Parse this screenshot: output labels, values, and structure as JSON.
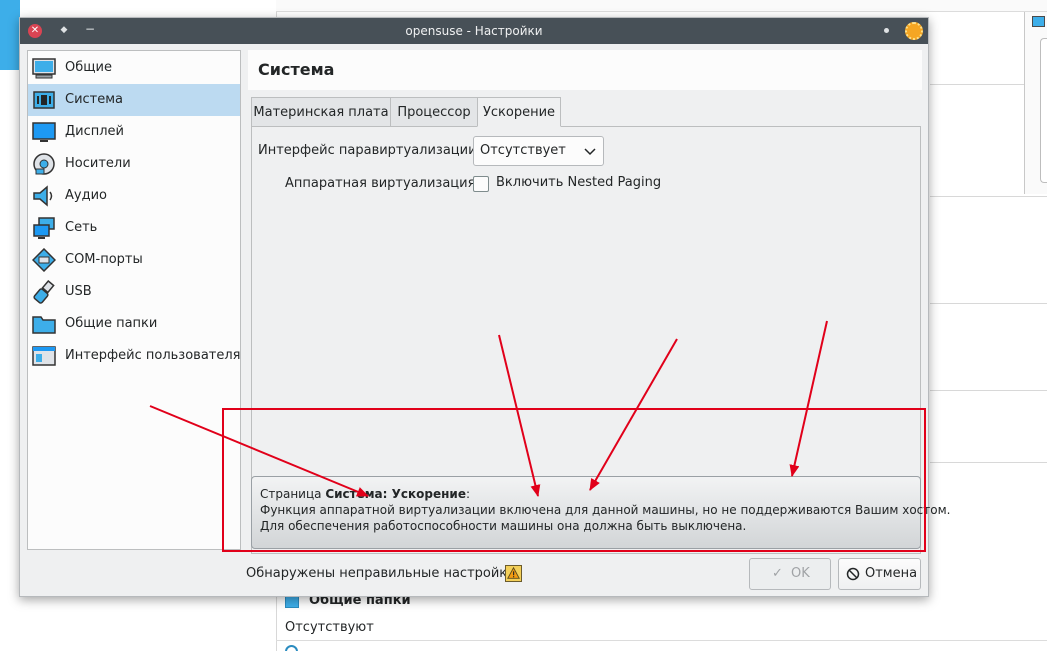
{
  "dialog": {
    "title": "opensuse - Настройки"
  },
  "sidebar": {
    "items": [
      {
        "label": "Общие",
        "icon": "general-icon"
      },
      {
        "label": "Система",
        "icon": "chip-icon",
        "selected": true
      },
      {
        "label": "Дисплей",
        "icon": "monitor-icon"
      },
      {
        "label": "Носители",
        "icon": "disk-icon"
      },
      {
        "label": "Аудио",
        "icon": "speaker-icon"
      },
      {
        "label": "Сеть",
        "icon": "network-icon"
      },
      {
        "label": "COM-порты",
        "icon": "serial-port-icon"
      },
      {
        "label": "USB",
        "icon": "usb-icon"
      },
      {
        "label": "Общие папки",
        "icon": "folder-icon"
      },
      {
        "label": "Интерфейс пользователя",
        "icon": "ui-window-icon"
      }
    ]
  },
  "page": {
    "title": "Система",
    "tabs": [
      {
        "label": "Материнская плата"
      },
      {
        "label": "Процессор"
      },
      {
        "label": "Ускорение",
        "active": true
      }
    ],
    "paravirt_label": "Интерфейс паравиртуализации:",
    "paravirt_value": "Отсутствует",
    "hwvirt_label": "Аппаратная виртуализация:",
    "nested_paging_label": "Включить Nested Paging",
    "nested_paging_checked": false
  },
  "warning": {
    "prefix": "Страница ",
    "page_ref": "Система: Ускорение",
    "suffix": ":",
    "line2": "Функция аппаратной виртуализации включена для данной машины, но не поддерживаются Вашим хостом.",
    "line3": "Для обеспечения работоспособности машины она должна быть выключена."
  },
  "footer": {
    "invalid_settings_text": "Обнаружены неправильные настройки",
    "ok_label": "OK",
    "ok_enabled": false,
    "cancel_label": "Отмена"
  },
  "background": {
    "section_title": "Общие папки",
    "section_value": "Отсутствуют"
  },
  "colors": {
    "titlebar": "#475057",
    "selection": "#bcdaf1",
    "annotation_red": "#e1001a",
    "accent": "#3daee9"
  }
}
